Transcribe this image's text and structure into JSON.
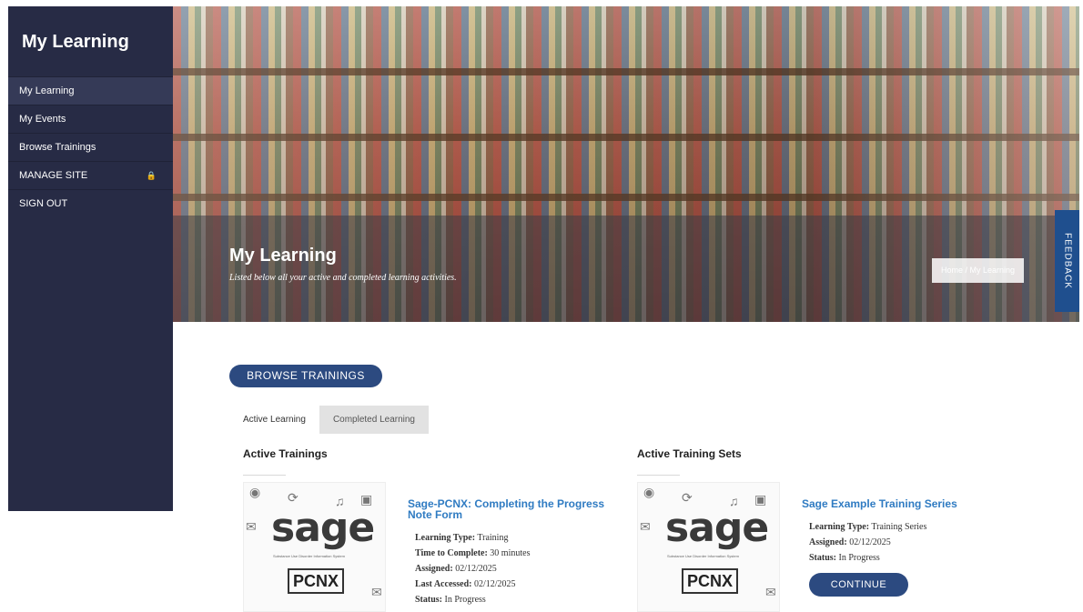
{
  "sidebar": {
    "title": "My Learning",
    "items": [
      {
        "label": "My Learning"
      },
      {
        "label": "My Events"
      },
      {
        "label": "Browse Trainings"
      },
      {
        "label": "MANAGE SITE"
      },
      {
        "label": "SIGN OUT"
      }
    ]
  },
  "hero": {
    "title": "My Learning",
    "subtitle": "Listed below all your active and completed learning activities.",
    "breadcrumb": "Home / My Learning"
  },
  "feedback_label": "FEEDBACK",
  "main": {
    "browse_button": "BROWSE TRAININGS",
    "tabs": [
      {
        "label": "Active Learning"
      },
      {
        "label": "Completed Learning"
      }
    ],
    "active_trainings": {
      "heading": "Active Trainings",
      "card": {
        "thumb_logo": "sage",
        "thumb_tagline": "Substance Use Disorder Information System",
        "thumb_badge": "PCNX",
        "title": "Sage-PCNX: Completing the Progress Note Form",
        "learning_type_label": "Learning Type:",
        "learning_type": "Training",
        "time_label": "Time to Complete:",
        "time": "30 minutes",
        "assigned_label": "Assigned:",
        "assigned": "02/12/2025",
        "last_accessed_label": "Last Accessed:",
        "last_accessed": "02/12/2025",
        "status_label": "Status:",
        "status": "In Progress"
      }
    },
    "active_sets": {
      "heading": "Active Training Sets",
      "card": {
        "thumb_logo": "sage",
        "thumb_tagline": "Substance Use Disorder Information System",
        "thumb_badge": "PCNX",
        "title": "Sage Example Training Series",
        "learning_type_label": "Learning Type:",
        "learning_type": "Training Series",
        "assigned_label": "Assigned:",
        "assigned": "02/12/2025",
        "status_label": "Status:",
        "status": "In Progress",
        "continue_button": "CONTINUE"
      }
    }
  },
  "colors": {
    "sidebar_bg": "#272b45",
    "accent_button": "#2c4a80",
    "link_blue": "#2f7bc2",
    "feedback_tab": "#1f4f8e"
  }
}
